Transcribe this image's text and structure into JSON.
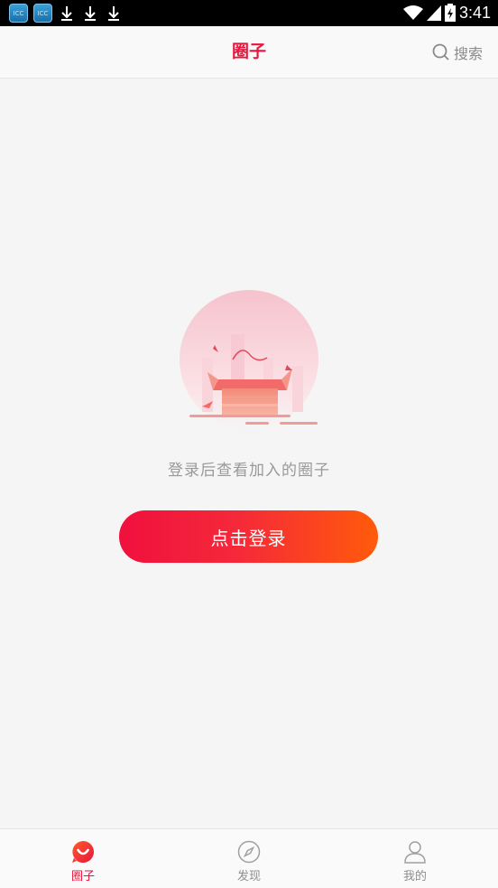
{
  "status_bar": {
    "time": "3:41",
    "app_icon_text": "ICC",
    "left_icons": [
      "app-icon",
      "app-icon",
      "download-icon",
      "download-icon",
      "download-icon"
    ],
    "right_icons": [
      "wifi-icon",
      "signal-icon",
      "battery-icon"
    ]
  },
  "header": {
    "title": "圈子",
    "search_label": "搜索"
  },
  "empty_state": {
    "message": "登录后查看加入的圈子",
    "login_button": "点击登录"
  },
  "bottom_nav": {
    "items": [
      {
        "label": "圈子",
        "icon": "circle-chat-icon",
        "active": true
      },
      {
        "label": "发现",
        "icon": "compass-icon",
        "active": false
      },
      {
        "label": "我的",
        "icon": "user-icon",
        "active": false
      }
    ]
  },
  "colors": {
    "accent": "#e8163c",
    "button_gradient_start": "#f0103d",
    "button_gradient_end": "#ff5b0a",
    "inactive": "#8e8e8e"
  }
}
